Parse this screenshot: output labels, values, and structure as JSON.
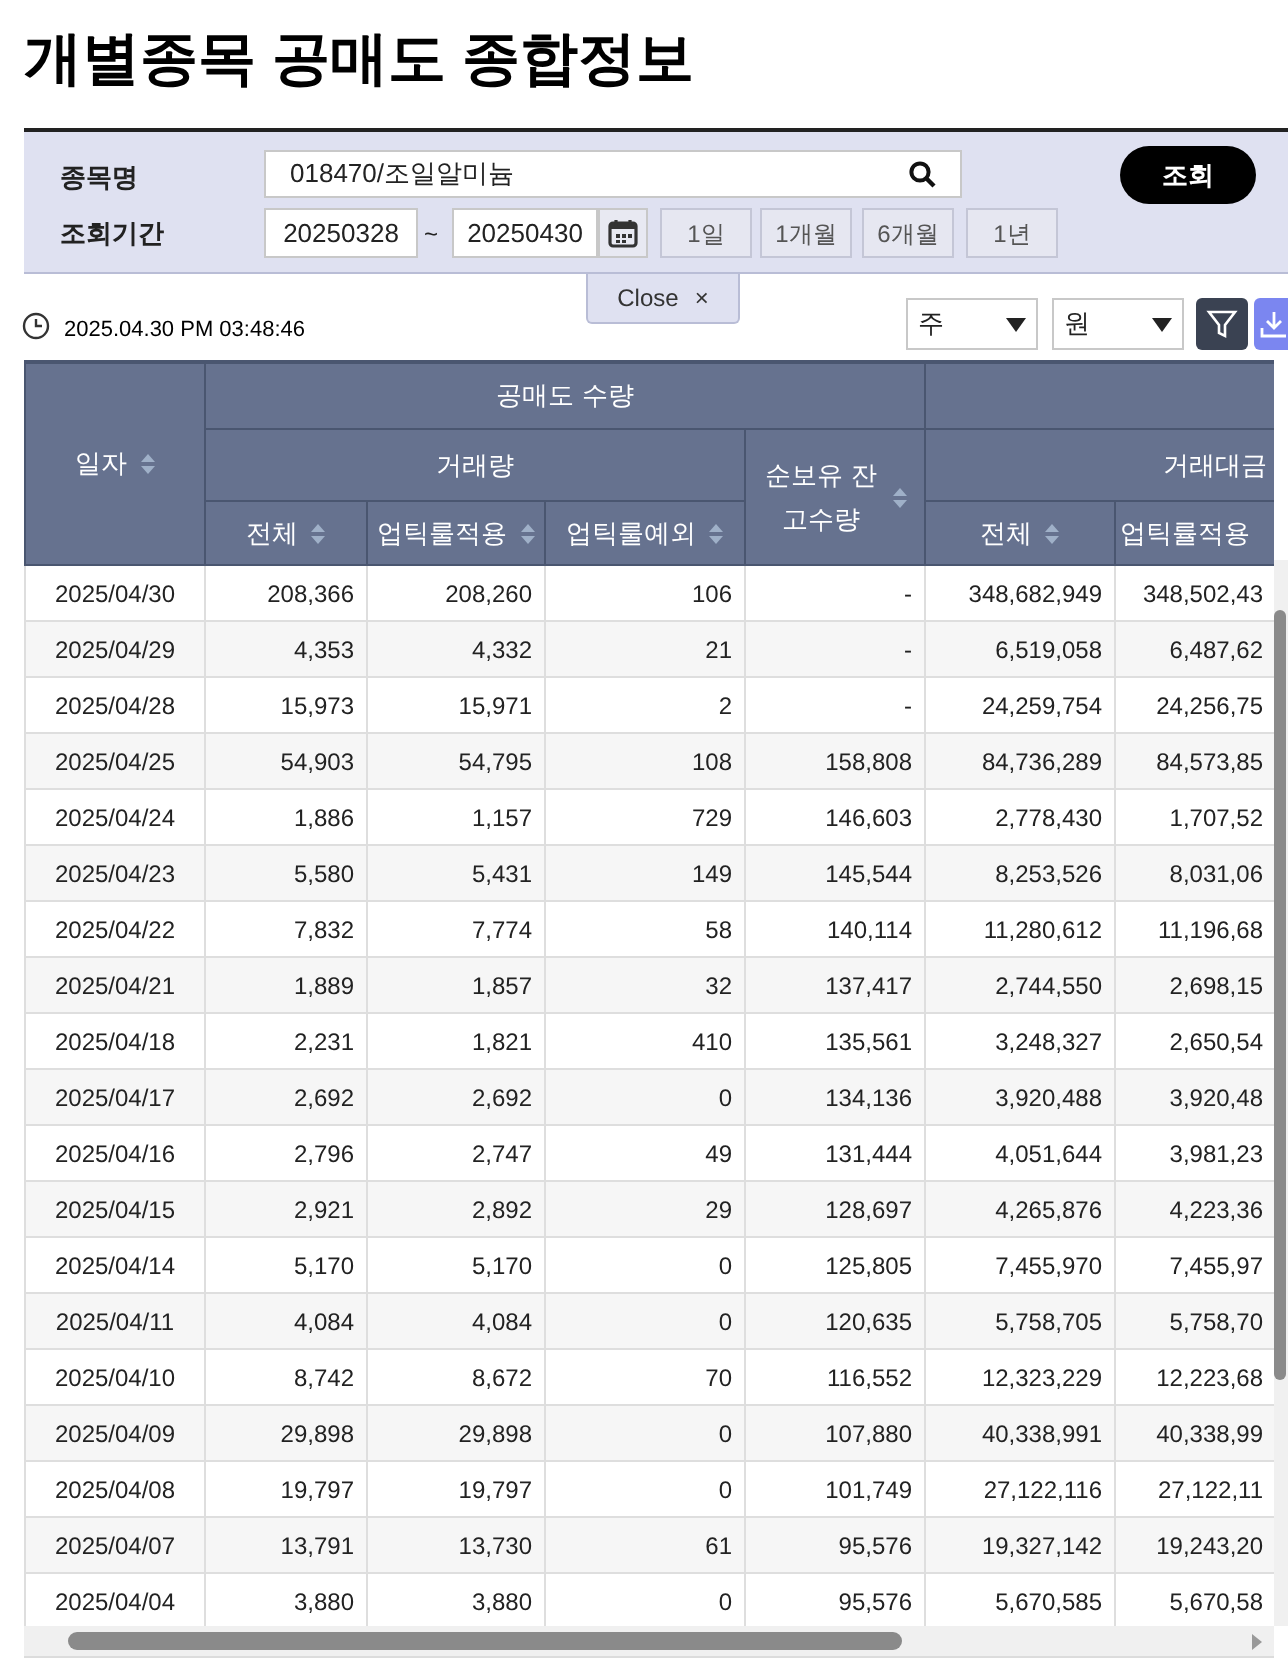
{
  "title": "개별종목 공매도 종합정보",
  "search": {
    "name_label": "종목명",
    "name_value": "018470/조일알미늄",
    "period_label": "조회기간",
    "start": "20250328",
    "separator": "~",
    "end": "20250430",
    "ranges": [
      "1일",
      "1개월",
      "6개월",
      "1년"
    ],
    "submit": "조회"
  },
  "close": {
    "label": "Close",
    "icon": "×"
  },
  "timestamp": "2025.04.30 PM 03:48:46",
  "selects": [
    {
      "value": "주"
    },
    {
      "value": "원"
    }
  ],
  "table": {
    "group_header": "공매도 수량",
    "volume_header": "거래량",
    "amount_header": "거래대금",
    "columns": [
      "일자",
      "전체",
      "업틱룰적용",
      "업틱룰예외",
      "순보유 잔고수량",
      "전체",
      "업틱률적용"
    ],
    "rows": [
      [
        "2025/04/30",
        "208,366",
        "208,260",
        "106",
        "-",
        "348,682,949",
        "348,502,43"
      ],
      [
        "2025/04/29",
        "4,353",
        "4,332",
        "21",
        "-",
        "6,519,058",
        "6,487,62"
      ],
      [
        "2025/04/28",
        "15,973",
        "15,971",
        "2",
        "-",
        "24,259,754",
        "24,256,75"
      ],
      [
        "2025/04/25",
        "54,903",
        "54,795",
        "108",
        "158,808",
        "84,736,289",
        "84,573,85"
      ],
      [
        "2025/04/24",
        "1,886",
        "1,157",
        "729",
        "146,603",
        "2,778,430",
        "1,707,52"
      ],
      [
        "2025/04/23",
        "5,580",
        "5,431",
        "149",
        "145,544",
        "8,253,526",
        "8,031,06"
      ],
      [
        "2025/04/22",
        "7,832",
        "7,774",
        "58",
        "140,114",
        "11,280,612",
        "11,196,68"
      ],
      [
        "2025/04/21",
        "1,889",
        "1,857",
        "32",
        "137,417",
        "2,744,550",
        "2,698,15"
      ],
      [
        "2025/04/18",
        "2,231",
        "1,821",
        "410",
        "135,561",
        "3,248,327",
        "2,650,54"
      ],
      [
        "2025/04/17",
        "2,692",
        "2,692",
        "0",
        "134,136",
        "3,920,488",
        "3,920,48"
      ],
      [
        "2025/04/16",
        "2,796",
        "2,747",
        "49",
        "131,444",
        "4,051,644",
        "3,981,23"
      ],
      [
        "2025/04/15",
        "2,921",
        "2,892",
        "29",
        "128,697",
        "4,265,876",
        "4,223,36"
      ],
      [
        "2025/04/14",
        "5,170",
        "5,170",
        "0",
        "125,805",
        "7,455,970",
        "7,455,97"
      ],
      [
        "2025/04/11",
        "4,084",
        "4,084",
        "0",
        "120,635",
        "5,758,705",
        "5,758,70"
      ],
      [
        "2025/04/10",
        "8,742",
        "8,672",
        "70",
        "116,552",
        "12,323,229",
        "12,223,68"
      ],
      [
        "2025/04/09",
        "29,898",
        "29,898",
        "0",
        "107,880",
        "40,338,991",
        "40,338,99"
      ],
      [
        "2025/04/08",
        "19,797",
        "19,797",
        "0",
        "101,749",
        "27,122,116",
        "27,122,11"
      ],
      [
        "2025/04/07",
        "13,791",
        "13,730",
        "61",
        "95,576",
        "19,327,142",
        "19,243,20"
      ],
      [
        "2025/04/04",
        "3,880",
        "3,880",
        "0",
        "95,576",
        "5,670,585",
        "5,670,58"
      ]
    ]
  }
}
